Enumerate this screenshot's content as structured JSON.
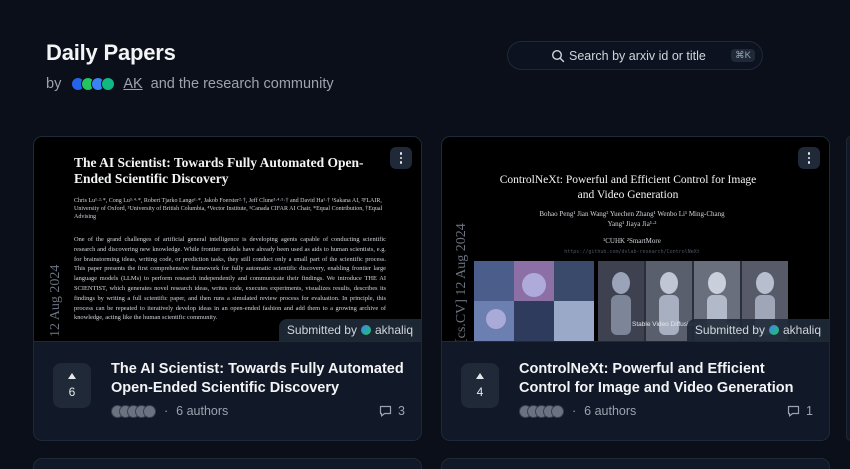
{
  "header": {
    "title": "Daily Papers",
    "by": "by",
    "author_link": "AK",
    "suffix": "and the research community"
  },
  "search": {
    "placeholder": "Search by arxiv id or title",
    "shortcut": "⌘K"
  },
  "papers": [
    {
      "title": "The AI Scientist: Towards Fully Automated Open-Ended Scientific Discovery",
      "upvotes": "6",
      "authors": "6 authors",
      "comments": "3",
      "submitted_by": "Submitted by",
      "submitter": "akhaliq",
      "preview": {
        "title": "The AI Scientist: Towards Fully Automated Open-Ended Scientific Discovery",
        "authors": "Chris Lu¹·²·*, Cong Lu³·⁴·*, Robert Tjarko Lange¹·*, Jakob Foerster²·†, Jeff Clune³·⁴·⁵·† and David Ha¹·† ¹Sakana AI, ²FLAIR, University of Oxford, ³University of British Columbia, ⁴Vector Institute, ⁵Canada CIFAR AI Chair, *Equal Contribution, †Equal Advising",
        "abstract": "One of the grand challenges of artificial general intelligence is developing agents capable of conducting scientific research and discovering new knowledge. While frontier models have already been used as aids to human scientists, e.g. for brainstorming ideas, writing code, or prediction tasks, they still conduct only a small part of the scientific process. This paper presents the first comprehensive framework for fully automatic scientific discovery, enabling frontier large language models (LLMs) to perform research independently and communicate their findings. We introduce THE AI SCIENTIST, which generates novel research ideas, writes code, executes experiments, visualizes results, describes its findings by writing a full scientific paper, and then runs a simulated review process for evaluation. In principle, this process can be repeated to iteratively develop ideas in an open-ended fashion and add them to a growing archive of knowledge, acting like the human scientific community.",
        "side": "12 Aug 2024"
      }
    },
    {
      "title": "ControlNeXt: Powerful and Efficient Control for Image and Video Generation",
      "upvotes": "4",
      "authors": "6 authors",
      "comments": "1",
      "submitted_by": "Submitted by",
      "submitter": "akhaliq",
      "preview": {
        "title": "ControlNeXt: Powerful and Efficient Control for Image and Video Generation",
        "authors": "Bohao Peng¹ Jian Wang² Yuechen Zhang¹ Wenbo Li¹ Ming-Chang Yang¹ Jiaya Jia¹·²",
        "affil": "¹CUHK ²SmartMore",
        "url": "https://github.com/dvlab-research/ControlNeXt",
        "side": "[cs.CV] 12 Aug 2024",
        "caption": "Stable Video Diffusion + ControlNeXt"
      }
    }
  ],
  "colors": {
    "background": "#0b0f19",
    "card": "#111827",
    "border": "#1f2937"
  }
}
